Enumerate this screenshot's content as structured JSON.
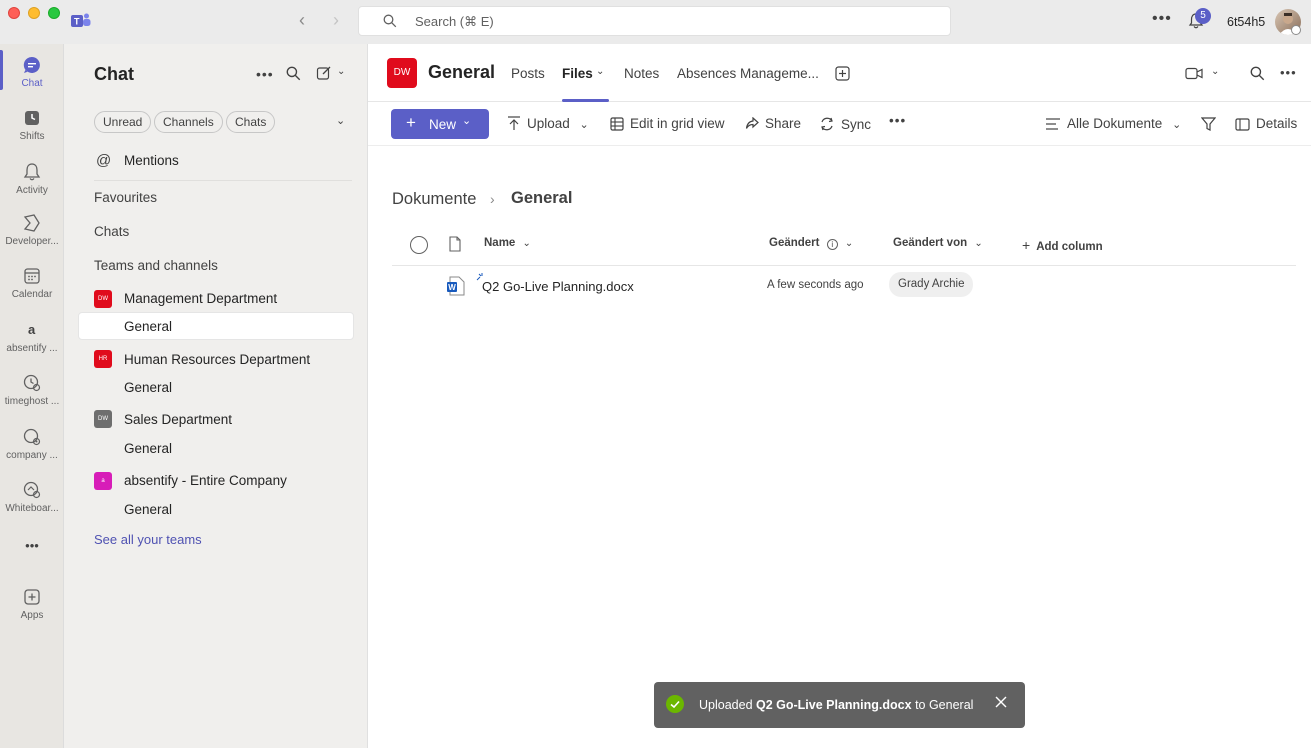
{
  "titlebar": {
    "search_placeholder": "Search (⌘ E)",
    "notification_count": "5",
    "username": "6t54h5"
  },
  "rail": {
    "items": [
      {
        "label": "Chat",
        "icon": "chat-icon",
        "active": true
      },
      {
        "label": "Shifts",
        "icon": "shifts-icon"
      },
      {
        "label": "Activity",
        "icon": "bell-icon"
      },
      {
        "label": "Developer...",
        "icon": "developer-icon"
      },
      {
        "label": "Calendar",
        "icon": "calendar-icon"
      },
      {
        "label": "absentify ...",
        "icon": "absentify-icon"
      },
      {
        "label": "timeghost ...",
        "icon": "timeghost-icon"
      },
      {
        "label": "company ...",
        "icon": "company-icon"
      },
      {
        "label": "Whiteboar...",
        "icon": "whiteboard-icon"
      },
      {
        "label": "Apps",
        "icon": "apps-icon"
      }
    ],
    "more": "•••"
  },
  "chat": {
    "title": "Chat",
    "filters": [
      "Unread",
      "Channels",
      "Chats"
    ],
    "mentions": "Mentions",
    "favourites": "Favourites",
    "chats": "Chats",
    "teams_heading": "Teams and channels",
    "teams": [
      {
        "name": "Management Department",
        "badge": "DW",
        "color": "#e00b1c",
        "channel": "General"
      },
      {
        "name": "Human Resources Department",
        "badge": "HR",
        "color": "#e00b1c",
        "channel": "General"
      },
      {
        "name": "Sales Department",
        "badge": "DW",
        "color": "#6e6e6e",
        "channel": "General"
      },
      {
        "name": "absentify - Entire Company",
        "badge": "a",
        "color": "#d71db8",
        "channel": "General"
      }
    ],
    "see_all": "See all your teams"
  },
  "header": {
    "avatar": "DW",
    "title": "General",
    "tabs": [
      "Posts",
      "Files",
      "Notes",
      "Absences Manageme..."
    ]
  },
  "toolbar": {
    "new": "New",
    "upload": "Upload",
    "grid": "Edit in grid view",
    "share": "Share",
    "sync": "Sync",
    "view": "Alle Dokumente",
    "details": "Details"
  },
  "files": {
    "breadcrumb_root": "Dokumente",
    "breadcrumb_current": "General",
    "columns": {
      "name": "Name",
      "modified": "Geändert",
      "modified_by": "Geändert von",
      "add": "Add column"
    },
    "rows": [
      {
        "name": "Q2 Go-Live Planning.docx",
        "modified": "A few seconds ago",
        "modified_by": "Grady Archie"
      }
    ]
  },
  "toast": {
    "prefix": "Uploaded ",
    "file": "Q2 Go-Live Planning.docx",
    "suffix": " to General"
  }
}
